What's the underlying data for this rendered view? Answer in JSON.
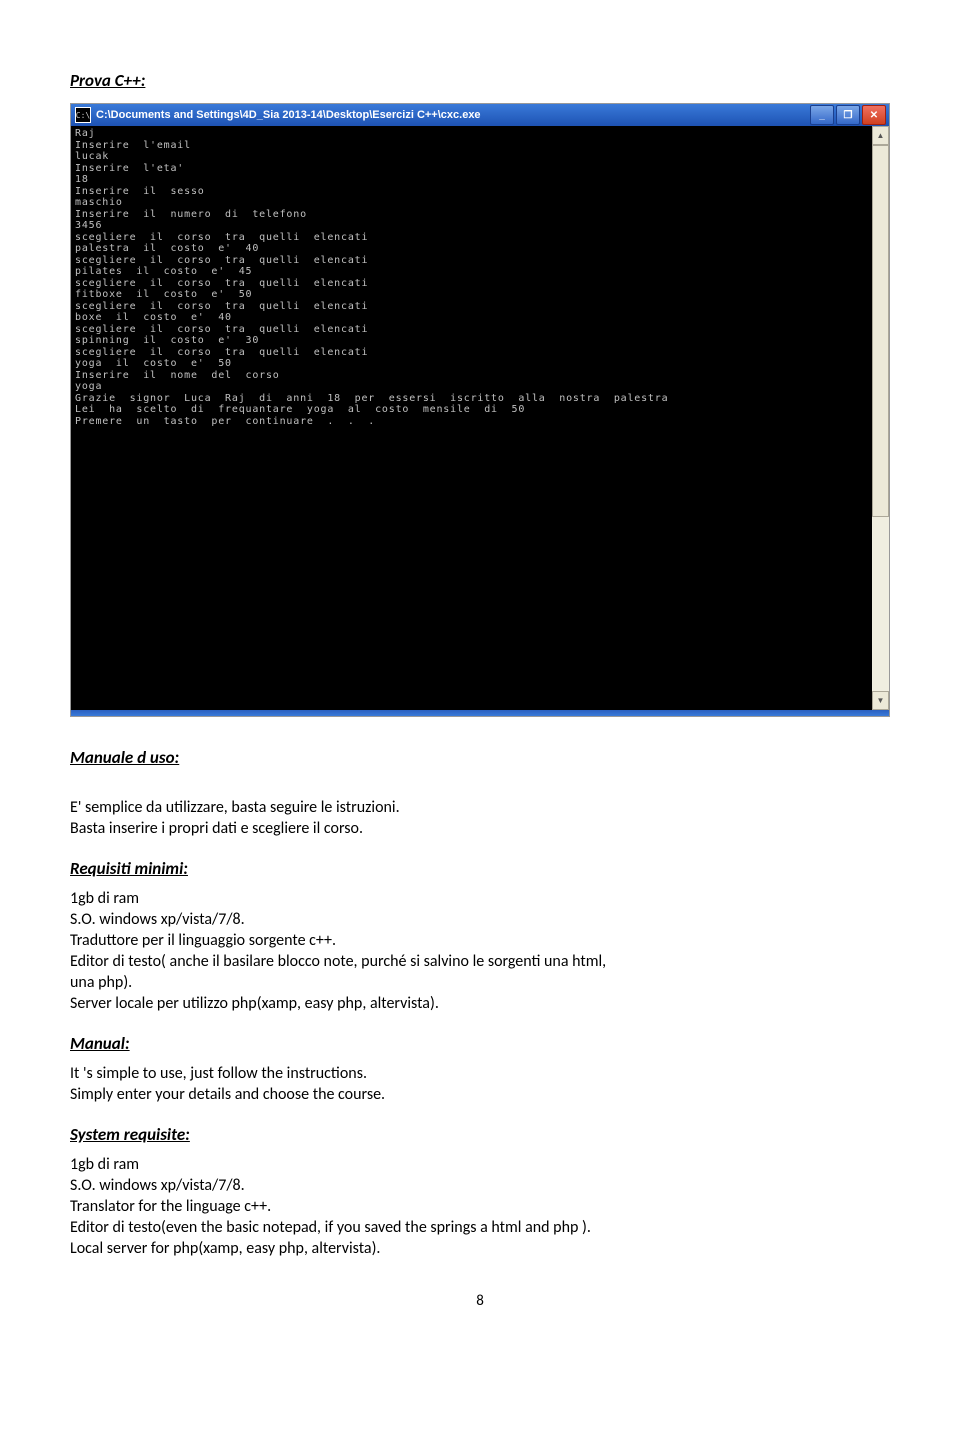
{
  "heading_prova": "Prova C++:",
  "titlebar_path": "C:\\Documents and Settings\\4D_Sia 2013-14\\Desktop\\Esercizi C++\\cxc.exe",
  "titlebar_icon_text": "C:\\",
  "console_lines": [
    "Raj",
    "Inserire  l'email",
    "lucak",
    "Inserire  l'eta'",
    "18",
    "Inserire  il  sesso",
    "maschio",
    "Inserire  il  numero  di  telefono",
    "3456",
    "scegliere  il  corso  tra  quelli  elencati",
    "palestra  il  costo  e'  40",
    "scegliere  il  corso  tra  quelli  elencati",
    "pilates  il  costo  e'  45",
    "scegliere  il  corso  tra  quelli  elencati",
    "fitboxe  il  costo  e'  50",
    "scegliere  il  corso  tra  quelli  elencati",
    "boxe  il  costo  e'  40",
    "scegliere  il  corso  tra  quelli  elencati",
    "spinning  il  costo  e'  30",
    "scegliere  il  corso  tra  quelli  elencati",
    "yoga  il  costo  e'  50",
    "Inserire  il  nome  del  corso",
    "yoga",
    "Grazie  signor  Luca  Raj  di  anni  18  per  essersi  iscritto  alla  nostra  palestra",
    "Lei  ha  scelto  di  frequantare  yoga  al  costo  mensile  di  50",
    "Premere  un  tasto  per  continuare  .  .  ."
  ],
  "heading_manuale": "Manuale d uso:",
  "manuale_p1": "E' semplice da utilizzare, basta seguire le istruzioni.",
  "manuale_p2": " Basta inserire i propri dati e scegliere il corso.",
  "heading_requisiti": "Requisiti minimi:",
  "req_l1": "1gb di ram",
  "req_l2": "S.O. windows xp/vista/7/8.",
  "req_l3": "Traduttore per il linguaggio sorgente c++.",
  "req_l4": "Editor di testo( anche il basilare blocco note, purché si salvino le sorgenti una html,",
  "req_l5": "una php).",
  "req_l6": "Server locale per utilizzo php(xamp, easy php, altervista).",
  "heading_manual_en": "Manual:",
  "man_en_l1": "It 's simple to use, just follow the instructions.",
  "man_en_l2": " Simply enter your details and choose the course.",
  "heading_system": "System requisite:",
  "sys_l1": "1gb di ram",
  "sys_l2": "S.O. windows xp/vista/7/8.",
  "sys_l3": "Translator for the linguage c++.",
  "sys_l4": "Editor di testo(even the basic notepad, if you saved the springs a html and php ).",
  "sys_l5": "Local server for php(xamp, easy php, altervista).",
  "page_number": "8",
  "btn_min": "_",
  "btn_max": "❐",
  "btn_close": "✕",
  "arrow_up": "▲",
  "arrow_down": "▼"
}
